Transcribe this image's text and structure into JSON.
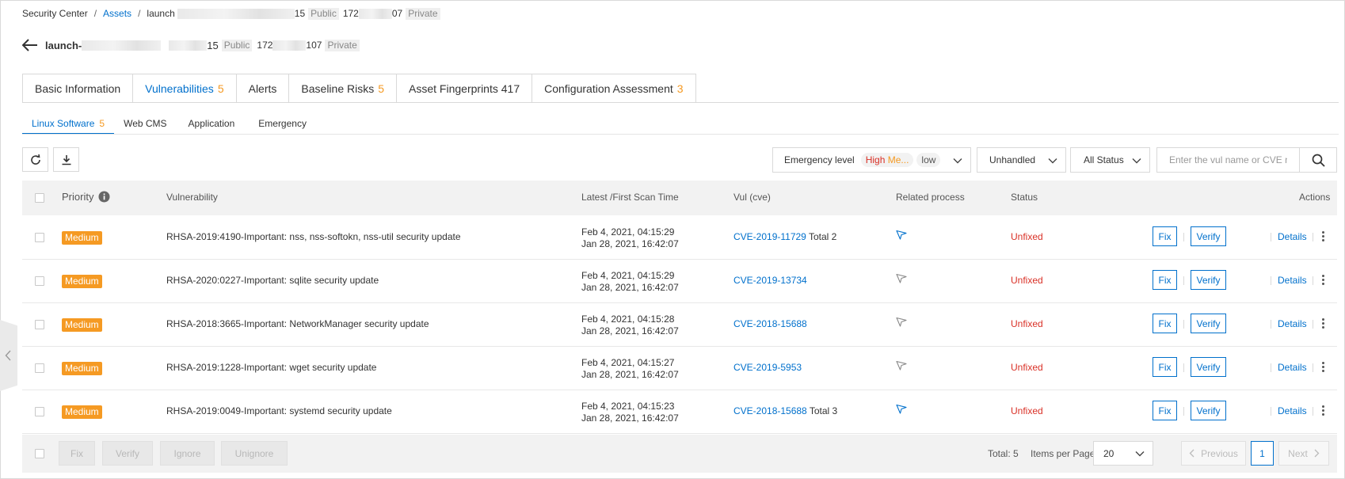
{
  "breadcrumb": {
    "root": "Security Center",
    "assets": "Assets",
    "host_prefix": "launch",
    "ip_public_suffix": "15",
    "public_tag": "Public",
    "ip_private_prefix": "172",
    "ip_private_suffix": "07",
    "private_tag": "Private"
  },
  "header": {
    "host_prefix": "launch-",
    "ip_public_suffix": "15",
    "public_tag": "Public",
    "ip_private_prefix": "172",
    "ip_private_suffix": "107",
    "private_tag": "Private"
  },
  "tabs": [
    {
      "label": "Basic Information",
      "count": ""
    },
    {
      "label": "Vulnerabilities",
      "count": "5"
    },
    {
      "label": "Alerts",
      "count": ""
    },
    {
      "label": "Baseline Risks",
      "count": "5"
    },
    {
      "label": "Asset Fingerprints 417",
      "count": ""
    },
    {
      "label": "Configuration Assessment",
      "count": "3"
    }
  ],
  "subtabs": [
    {
      "label": "Linux Software",
      "count": "5"
    },
    {
      "label": "Web CMS",
      "count": ""
    },
    {
      "label": "Application",
      "count": ""
    },
    {
      "label": "Emergency",
      "count": ""
    }
  ],
  "filters": {
    "emergency_label": "Emergency level",
    "level_high": "High",
    "level_medium": "Me...",
    "level_low": "low",
    "handled": "Unhandled",
    "status": "All Status",
    "search_placeholder": "Enter the vul name or CVE n"
  },
  "table": {
    "headers": {
      "priority": "Priority",
      "vulnerability": "Vulnerability",
      "scan_time": "Latest /First Scan Time",
      "cve": "Vul (cve)",
      "process": "Related process",
      "status": "Status",
      "actions": "Actions"
    },
    "rows": [
      {
        "priority": "Medium",
        "name": "RHSA-2019:4190-Important: nss, nss-softokn, nss-util security update",
        "latest": "Feb 4, 2021, 04:15:29",
        "first": "Jan 28, 2021, 16:42:07",
        "cve": "CVE-2019-11729",
        "cve_total": "Total 2",
        "status": "Unfixed",
        "fix": "Fix",
        "verify": "Verify",
        "details": "Details",
        "process_active": true
      },
      {
        "priority": "Medium",
        "name": "RHSA-2020:0227-Important: sqlite security update",
        "latest": "Feb 4, 2021, 04:15:29",
        "first": "Jan 28, 2021, 16:42:07",
        "cve": "CVE-2019-13734",
        "cve_total": "",
        "status": "Unfixed",
        "fix": "Fix",
        "verify": "Verify",
        "details": "Details",
        "process_active": false
      },
      {
        "priority": "Medium",
        "name": "RHSA-2018:3665-Important: NetworkManager security update",
        "latest": "Feb 4, 2021, 04:15:28",
        "first": "Jan 28, 2021, 16:42:07",
        "cve": "CVE-2018-15688",
        "cve_total": "",
        "status": "Unfixed",
        "fix": "Fix",
        "verify": "Verify",
        "details": "Details",
        "process_active": false
      },
      {
        "priority": "Medium",
        "name": "RHSA-2019:1228-Important: wget security update",
        "latest": "Feb 4, 2021, 04:15:27",
        "first": "Jan 28, 2021, 16:42:07",
        "cve": "CVE-2019-5953",
        "cve_total": "",
        "status": "Unfixed",
        "fix": "Fix",
        "verify": "Verify",
        "details": "Details",
        "process_active": false
      },
      {
        "priority": "Medium",
        "name": "RHSA-2019:0049-Important: systemd security update",
        "latest": "Feb 4, 2021, 04:15:23",
        "first": "Jan 28, 2021, 16:42:07",
        "cve": "CVE-2018-15688",
        "cve_total": "Total 3",
        "status": "Unfixed",
        "fix": "Fix",
        "verify": "Verify",
        "details": "Details",
        "process_active": true
      }
    ]
  },
  "footer": {
    "fix": "Fix",
    "verify": "Verify",
    "ignore": "Ignore",
    "unignore": "Unignore",
    "total": "Total: 5",
    "per_page_label": "Items per Page",
    "per_page_value": "20",
    "previous": "Previous",
    "page": "1",
    "next": "Next"
  },
  "colors": {
    "accent": "#0070cc",
    "count": "#f59a23",
    "badge": "#f59a23",
    "danger": "#d93026",
    "header_bg": "#f2f2f2",
    "border": "#d9d9d9"
  },
  "icons": {
    "back": "arrow-left-icon",
    "refresh": "refresh-icon",
    "download": "download-icon",
    "search": "search-icon",
    "info": "info-icon",
    "process": "send-icon",
    "more": "more-vertical-icon",
    "chevron": "chevron-down-icon"
  }
}
